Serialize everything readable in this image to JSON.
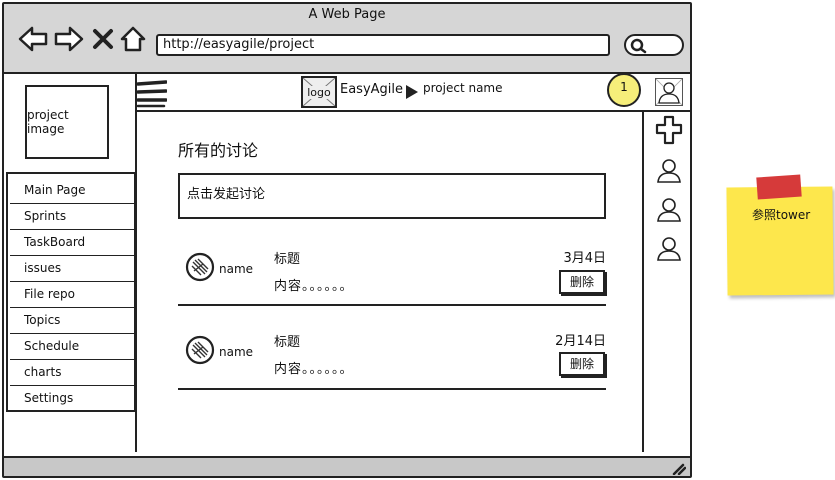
{
  "window": {
    "title": "A Web Page"
  },
  "address_bar": {
    "url": "http://easyagile/project"
  },
  "project_image": {
    "label": "project image"
  },
  "sidebar": {
    "items": [
      {
        "label": "Main Page"
      },
      {
        "label": "Sprints"
      },
      {
        "label": "TaskBoard"
      },
      {
        "label": "issues"
      },
      {
        "label": "File repo"
      },
      {
        "label": "Topics"
      },
      {
        "label": "Schedule"
      },
      {
        "label": "charts"
      },
      {
        "label": "Settings"
      }
    ]
  },
  "header": {
    "logo_label": "logo",
    "brand": "EasyAgile",
    "project_name": "project name",
    "notification_count": "1"
  },
  "main": {
    "title": "所有的讨论",
    "start_discussion": "点击发起讨论",
    "discussions": [
      {
        "author": "name",
        "title": "标题",
        "content": "内容。。。。。。",
        "date": "3月4日",
        "delete_label": "删除"
      },
      {
        "author": "name",
        "title": "标题",
        "content": "内容。。。。。。",
        "date": "2月14日",
        "delete_label": "删除"
      }
    ]
  },
  "sticky_note": {
    "text": "参照tower",
    "color": "#fde74c"
  },
  "colors": {
    "chrome": "#d6d6d6",
    "notification": "#f6ee7a",
    "sticky_tape": "#d63a3a"
  }
}
